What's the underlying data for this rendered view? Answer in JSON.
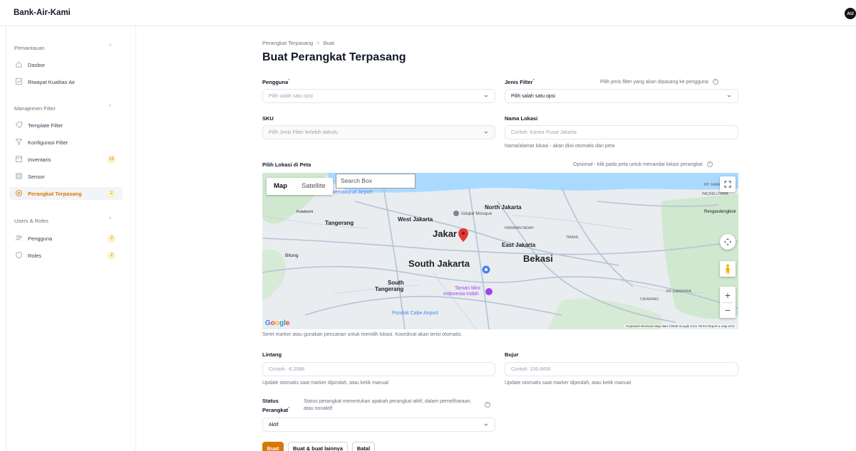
{
  "app": {
    "title": "Bank-Air-Kami",
    "user_initials": "AU"
  },
  "sidebar": {
    "sections": [
      {
        "title": "Pemantauan",
        "items": [
          {
            "label": "Dasbor",
            "icon": "home-icon"
          },
          {
            "label": "Riwayat Kualitas Air",
            "icon": "chart-icon"
          }
        ]
      },
      {
        "title": "Manajemen Filter",
        "items": [
          {
            "label": "Template Filter",
            "icon": "tag-icon"
          },
          {
            "label": "Konfigurasi Filter",
            "icon": "filter-icon"
          },
          {
            "label": "Inventaris",
            "icon": "box-icon",
            "badge": "15"
          },
          {
            "label": "Sensor",
            "icon": "cpu-icon"
          },
          {
            "label": "Perangkat Terpasang",
            "icon": "map-pin-icon",
            "badge": "2",
            "active": true
          }
        ]
      },
      {
        "title": "Users & Roles",
        "items": [
          {
            "label": "Pengguna",
            "icon": "users-icon",
            "badge": "2"
          },
          {
            "label": "Roles",
            "icon": "shield-icon",
            "badge": "2"
          }
        ]
      }
    ]
  },
  "breadcrumb": {
    "parent": "Perangkat Terpasang",
    "separator": ">",
    "current": "Buat"
  },
  "page_title": "Buat Perangkat Terpasang",
  "form": {
    "pengguna": {
      "label": "Pengguna",
      "required": "*",
      "placeholder": "Pilih salah satu opsi"
    },
    "jenis_filter": {
      "label": "Jenis Filter",
      "required": "*",
      "hint": "Pilih jenis filter yang akan dipasang ke pengguna",
      "value": "Pilih salah satu opsi"
    },
    "sku": {
      "label": "SKU",
      "placeholder": "Pilih Jenis Filter terlebih dahulu"
    },
    "nama_lokasi": {
      "label": "Nama Lokasi",
      "placeholder": "Contoh: Kantor Pusat Jakarta",
      "helper": "Nama/alamat lokasi - akan diisi otomatis dari peta"
    },
    "peta": {
      "label": "Pilih Lokasi di Peta",
      "hint": "Opsional - klik pada peta untuk menandai lokasi perangkat",
      "helper": "Seret marker atau gunakan pencarian untuk memilih lokasi. Koordinat akan terisi otomatis."
    },
    "lintang": {
      "label": "Lintang",
      "placeholder": "Contoh: -6.2088",
      "helper": "Update otomatis saat marker dipindah, atau ketik manual"
    },
    "bujur": {
      "label": "Bujur",
      "placeholder": "Contoh: 106.8456",
      "helper": "Update otomatis saat marker dipindah, atau ketik manual"
    },
    "status": {
      "label_line1": "Status",
      "label_line2": "Perangkat",
      "required": "*",
      "hint": "Status perangkat menentukan apakah perangkat aktif, dalam pemeliharaan, atau nonaktif",
      "value": "Aktif"
    }
  },
  "map": {
    "tabs": [
      "Map",
      "Satellite"
    ],
    "search_placeholder": "Search Box",
    "labels": {
      "jakarta": "Jakar",
      "south_jakarta": "South Jakarta",
      "bekasi": "Bekasi",
      "north_jakarta": "North Jakarta",
      "west_jakarta": "West Jakarta",
      "east_jakarta": "East Jakarta",
      "tangerang": "Tangerang",
      "south_tangerang_1": "South",
      "south_tangerang_2": "Tangerang",
      "taman_mini_1": "Taman Mini",
      "taman_mini_2": "Indonesia Indah",
      "istiqlal": "Istiqlal Mosque",
      "pondok_cabe": "Pondok Cabe Airport",
      "intl_airport": "International Airport",
      "bitung": "Bitung",
      "kutabumi": "Kutabumi",
      "rengasdengklok": "Rengasdengklok",
      "cikarang": "CIKARANG",
      "kp_gandaria": "KP. GANDARIA",
      "pacing_utara": "PACING UTARA",
      "kp_gawah": "KP. GAWAH",
      "taman": "TAMAN",
      "harapan_indah": "HARAPAN INDAH"
    },
    "footer": "Keyboard shortcuts   Map data ©2026 Google   5 km   Terms   Report a map error",
    "google": "Google"
  },
  "buttons": {
    "create": "Buat",
    "create_more": "Buat & buat lainnya",
    "cancel": "Batal"
  },
  "colors": {
    "accent": "#d97706",
    "badge_bg": "#fef3c7",
    "marker": "#e53935"
  }
}
